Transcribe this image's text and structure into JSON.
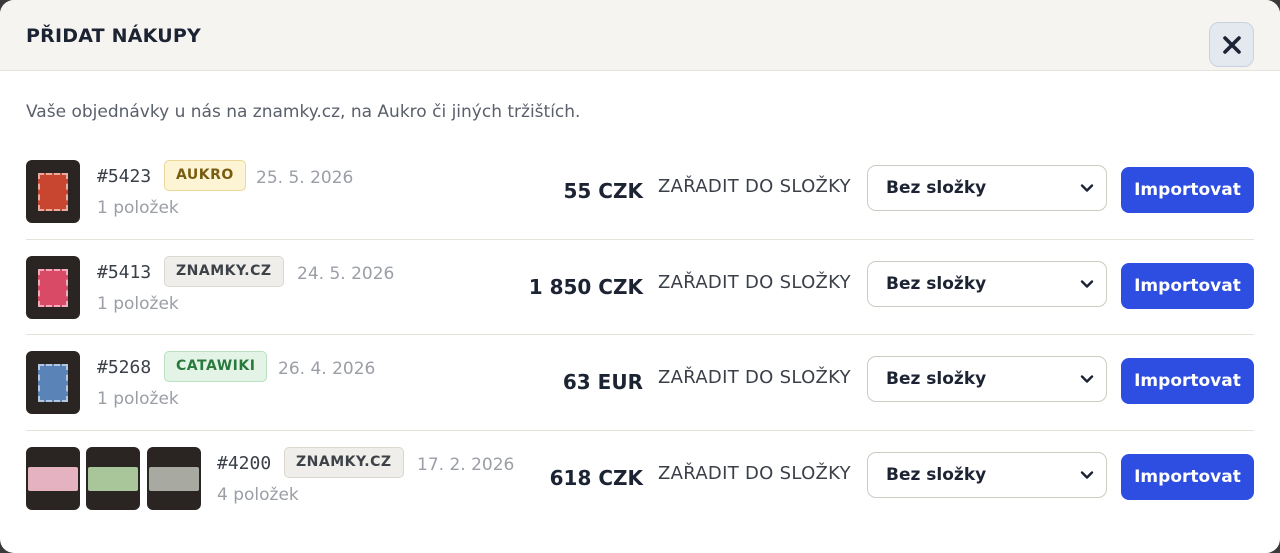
{
  "modal": {
    "title": "PŘIDAT NÁKUPY",
    "subtitle": "Vaše objednávky u nás na znamky.cz, na Aukro či jiných tržištích."
  },
  "common": {
    "folder_label": "ZAŘADIT DO SLOŽKY",
    "folder_value": "Bez složky",
    "import_label": "Importovat"
  },
  "orders": [
    {
      "id": "#5423",
      "source": "AUKRO",
      "date": "25. 5. 2026",
      "items": "1 položek",
      "price": "55 CZK",
      "thumbs": [
        "stamp-red"
      ]
    },
    {
      "id": "#5413",
      "source": "ZNAMKY.CZ",
      "date": "24. 5. 2026",
      "items": "1 položek",
      "price": "1 850 CZK",
      "thumbs": [
        "stamp-pink"
      ]
    },
    {
      "id": "#5268",
      "source": "CATAWIKI",
      "date": "26. 4. 2026",
      "items": "1 položek",
      "price": "63 EUR",
      "thumbs": [
        "stamp-blue"
      ]
    },
    {
      "id": "#4200",
      "source": "ZNAMKY.CZ",
      "date": "17. 2. 2026",
      "items": "4 položek",
      "price": "618 CZK",
      "thumbs": [
        "banknote-pink",
        "banknote-green",
        "banknote-gray"
      ]
    }
  ],
  "colors": {
    "accent": "#2d4ee0",
    "badge_aukro": "#fdf4d5",
    "badge_catawiki": "#e3f4e7",
    "badge_znamky": "#f0eeea"
  },
  "icons": {
    "close": "close-icon",
    "dropdown": "chevron-down-icon",
    "thumbnail": "stamp-thumbnail"
  }
}
